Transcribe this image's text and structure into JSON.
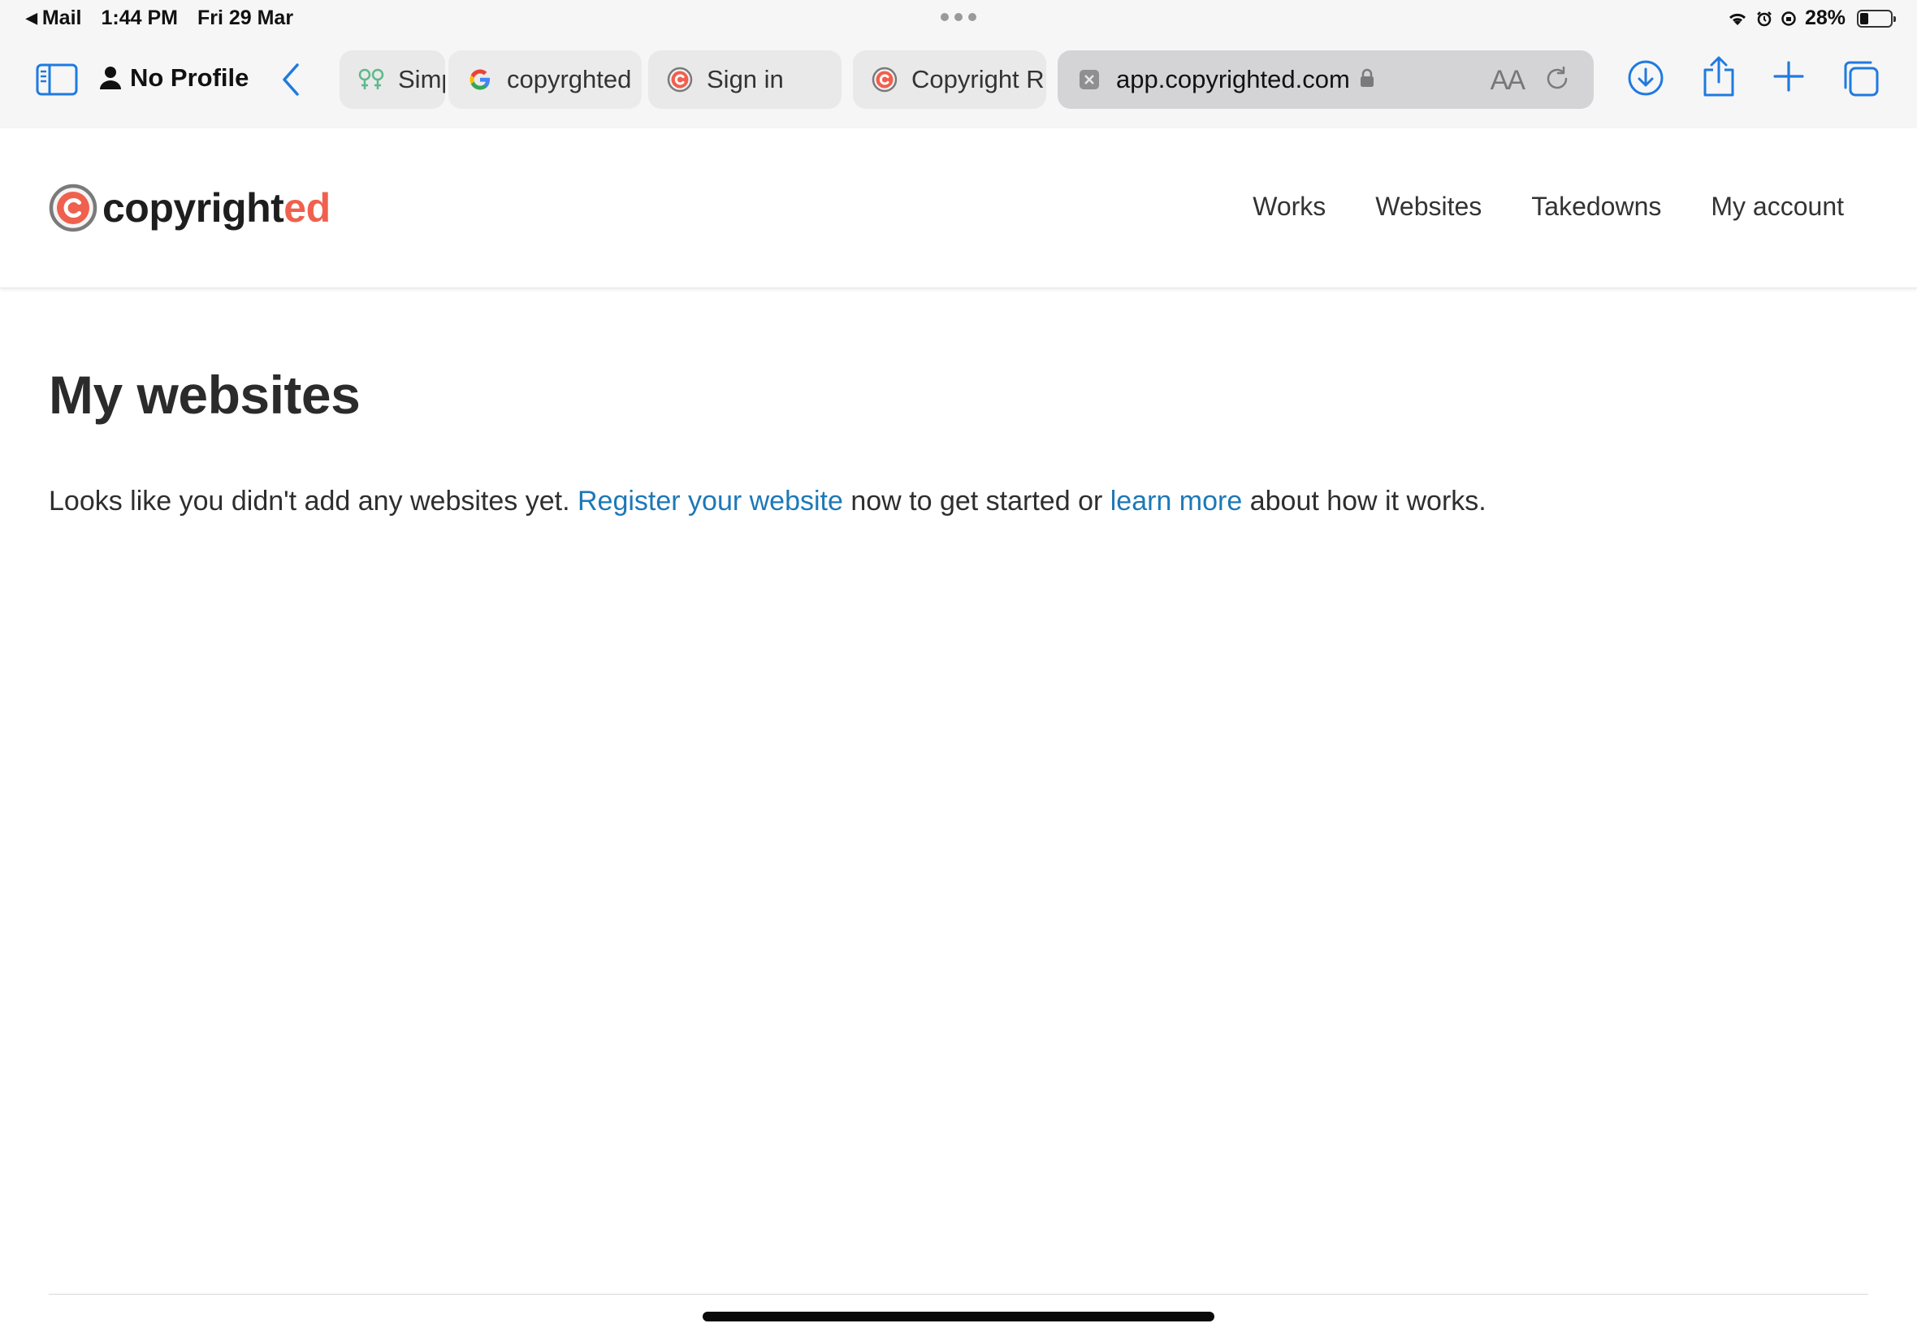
{
  "status_bar": {
    "back_app": "Mail",
    "time": "1:44 PM",
    "date": "Fri 29 Mar",
    "battery": "28%",
    "battery_level": 0.28
  },
  "browser": {
    "profile_label": "No Profile",
    "tabs": [
      {
        "title": "Simp",
        "favicon": "simple-icon"
      },
      {
        "title": "copyrghted",
        "favicon": "google-icon"
      },
      {
        "title": "Sign in",
        "favicon": "copyright-icon"
      },
      {
        "title": "Copyright R",
        "favicon": "copyright-icon"
      }
    ],
    "active_tab": {
      "url": "app.copyrighted.com",
      "favicon": "blank-favicon-icon",
      "reader_label": "AA"
    },
    "accent_color": "#1f7ae0"
  },
  "site": {
    "logo": {
      "main": "copyright",
      "accent": "ed"
    },
    "nav": [
      "Works",
      "Websites",
      "Takedowns",
      "My account"
    ],
    "brand_color": "#f0604e",
    "link_color": "#1d78b8"
  },
  "main": {
    "title": "My websites",
    "message": {
      "part1": "Looks like you didn't add any websites yet. ",
      "link1": "Register your website",
      "part2": " now to get started or ",
      "link2": "learn more",
      "part3": " about how it works."
    }
  }
}
